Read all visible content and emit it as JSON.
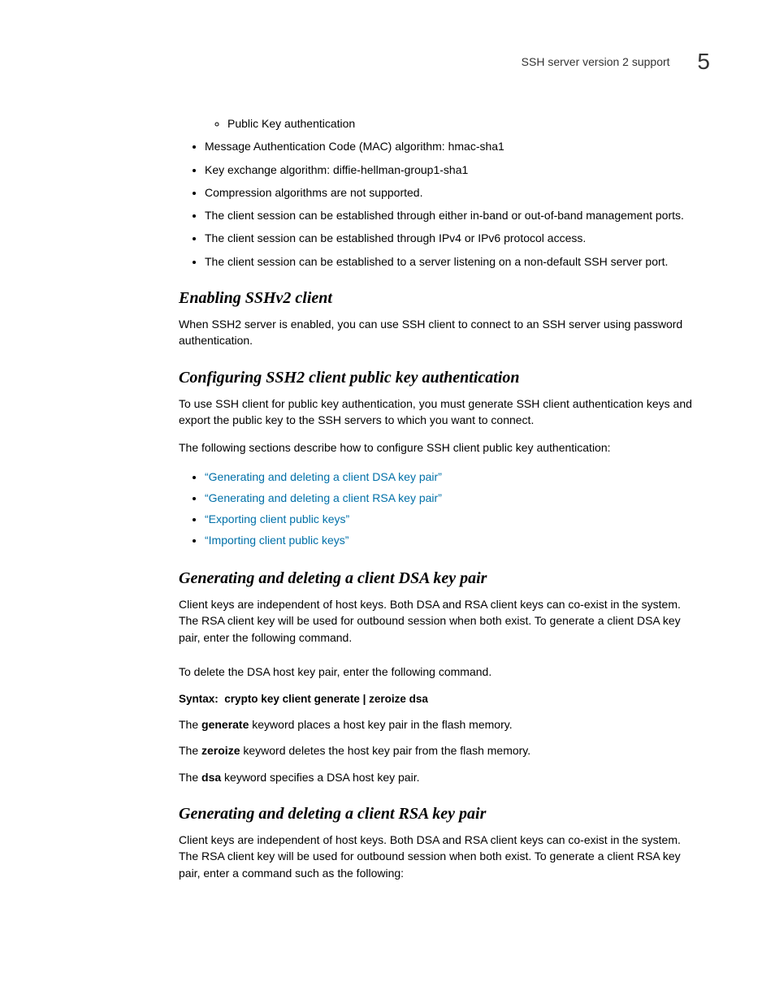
{
  "header": {
    "text": "SSH server version 2 support",
    "chapter_number": "5"
  },
  "top_bullets": {
    "nested": "Public Key authentication",
    "b1": "Message Authentication Code (MAC) algorithm: hmac-sha1",
    "b2": "Key exchange algorithm: diffie-hellman-group1-sha1",
    "b3": "Compression algorithms are not supported.",
    "b4": "The client session can be established through either in-band or out-of-band management ports.",
    "b5": "The client session can be established through IPv4 or IPv6 protocol access.",
    "b6": "The client session can be established to a server listening on a non-default SSH server port."
  },
  "s1": {
    "heading": "Enabling SSHv2 client",
    "p1": "When SSH2 server is enabled, you can use SSH client to connect to an SSH server using password authentication."
  },
  "s2": {
    "heading": "Configuring SSH2 client public key authentication",
    "p1": "To use SSH client for public key authentication, you must generate SSH client authentication keys and export the public key to the SSH servers to which you want to connect.",
    "p2": "The following sections describe how to configure SSH client public key authentication:",
    "links": {
      "l1": "Generating and deleting a client DSA key pair",
      "l2": "Generating and deleting a client RSA key pair",
      "l3": "Exporting client public keys",
      "l4": "Importing client public keys"
    }
  },
  "s3": {
    "heading": "Generating and deleting a client DSA key pair",
    "p1": "Client keys are independent of host keys. Both DSA and RSA client keys can co-exist in the system. The RSA client key will be used for outbound session when both exist. To generate a client DSA key pair, enter the following command.",
    "p2": "To delete the DSA host key pair, enter the following command.",
    "syntax_label": "Syntax:",
    "syntax_cmd": "crypto key client generate | zeroize dsa",
    "k1a": "The ",
    "k1b": "generate",
    "k1c": " keyword places a host key pair in the flash memory.",
    "k2a": "The ",
    "k2b": "zeroize",
    "k2c": " keyword deletes the host key pair from the flash memory.",
    "k3a": "The ",
    "k3b": "dsa",
    "k3c": " keyword specifies a DSA host key pair."
  },
  "s4": {
    "heading": "Generating and deleting a client RSA key pair",
    "p1": "Client keys are independent of host keys. Both DSA and RSA client keys can co-exist in the system. The RSA client key will be used for outbound session when both exist. To generate a client RSA key pair, enter a command such as the following:"
  }
}
